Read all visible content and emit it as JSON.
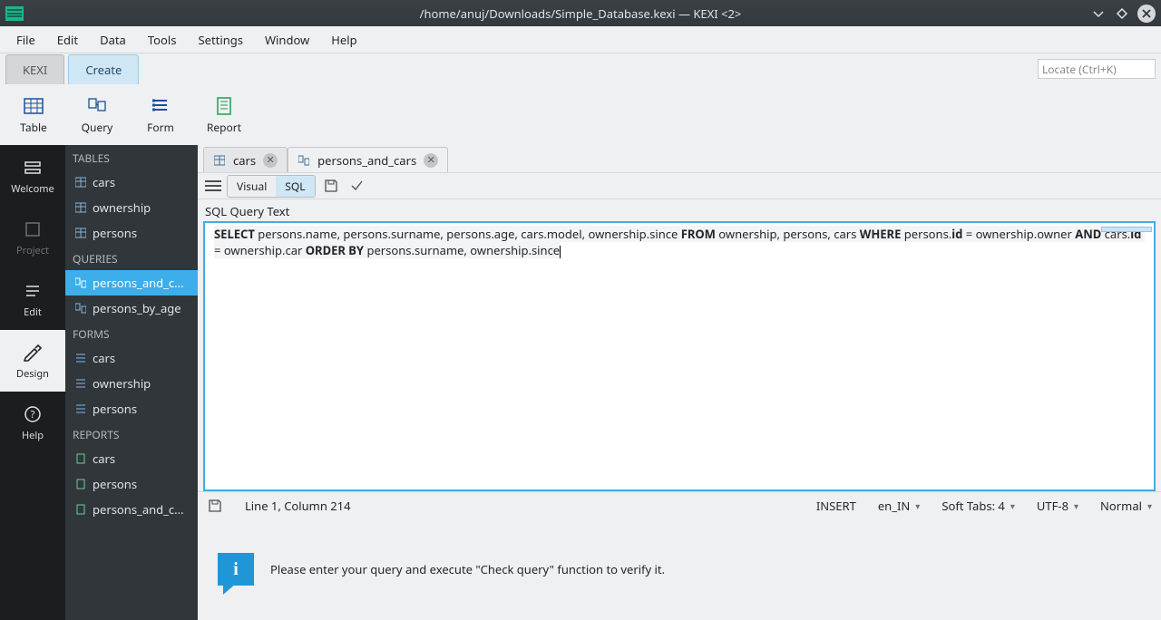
{
  "titlebar": {
    "title": "/home/anuj/Downloads/Simple_Database.kexi — KEXI <2>"
  },
  "menubar": [
    "File",
    "Edit",
    "Data",
    "Tools",
    "Settings",
    "Window",
    "Help"
  ],
  "bigtabs": {
    "kexi": "KEXI",
    "create": "Create"
  },
  "search_placeholder": "Locate (Ctrl+K)",
  "tools": {
    "table": "Table",
    "query": "Query",
    "form": "Form",
    "report": "Report"
  },
  "rail": {
    "welcome": "Welcome",
    "project": "Project",
    "edit": "Edit",
    "design": "Design",
    "help": "Help"
  },
  "tree": {
    "tables_hdr": "TABLES",
    "tables": [
      "cars",
      "ownership",
      "persons"
    ],
    "queries_hdr": "QUERIES",
    "queries": [
      "persons_and_c...",
      "persons_by_age"
    ],
    "forms_hdr": "FORMS",
    "forms": [
      "cars",
      "ownership",
      "persons"
    ],
    "reports_hdr": "REPORTS",
    "reports": [
      "cars",
      "persons",
      "persons_and_c..."
    ]
  },
  "doctabs": {
    "cars": "cars",
    "pac": "persons_and_cars"
  },
  "subbar": {
    "visual": "Visual",
    "sql": "SQL"
  },
  "query_label": "SQL Query Text",
  "sql": {
    "select": "SELECT",
    "fields": " persons.name, persons.surname, persons.age, cars.model, ownership.since ",
    "from": "FROM",
    "tables": " ownership, persons, cars ",
    "where": "WHERE",
    "cond1a": " persons.",
    "id1": "id",
    "cond1b": " = ownership.owner ",
    "and": "AND",
    "cond2a": " cars.",
    "id2": "id",
    "cond2b": " = ownership.car ",
    "orderby": "ORDER BY",
    "ordercols": " persons.surname, ownership.since"
  },
  "status": {
    "pos": "Line 1, Column 214",
    "mode": "INSERT",
    "locale": "en_IN",
    "tabs": "Soft Tabs: 4",
    "enc": "UTF-8",
    "wrap": "Normal"
  },
  "hint": "Please enter your query and execute \"Check query\" function to verify it."
}
